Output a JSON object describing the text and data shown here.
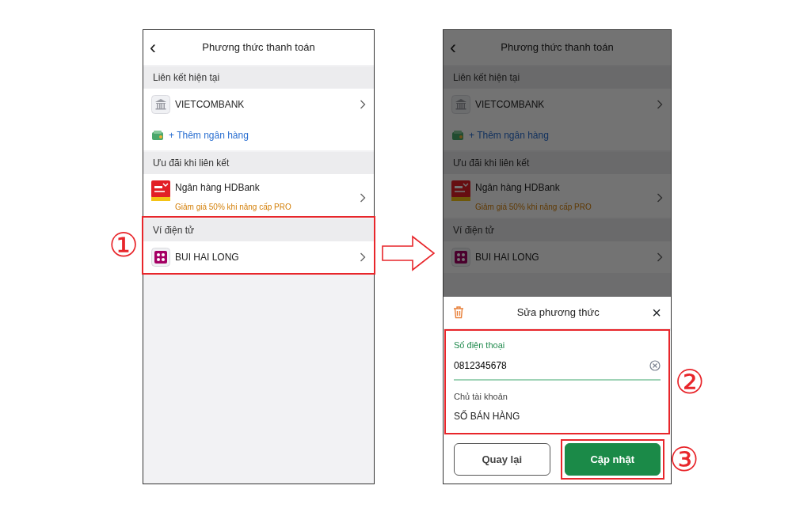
{
  "screens": [
    {
      "header": {
        "back": "‹",
        "title": "Phương thức thanh toán"
      },
      "dimmed": false,
      "sections": [
        {
          "title": "Liên kết hiện tại",
          "highlight": false,
          "rows": [
            {
              "kind": "bank_account",
              "name": "VIETCOMBANK"
            },
            {
              "kind": "add_bank",
              "name": "+ Thêm ngân hàng"
            }
          ]
        },
        {
          "title": "Ưu đãi khi liên kết",
          "highlight": false,
          "rows": [
            {
              "kind": "offer",
              "name": "Ngân hàng HDBank",
              "promo": "Giảm giá 50% khi nâng cấp PRO"
            }
          ]
        },
        {
          "title": "Ví điện tử",
          "highlight": true,
          "step": "①",
          "rows": [
            {
              "kind": "wallet_account",
              "name": "BUI HAI LONG"
            }
          ]
        }
      ]
    },
    {
      "header": {
        "back": "‹",
        "title": "Phương thức thanh toán"
      },
      "dimmed": true,
      "sections": [
        {
          "title": "Liên kết hiện tại",
          "highlight": false,
          "rows": [
            {
              "kind": "bank_account",
              "name": "VIETCOMBANK"
            },
            {
              "kind": "add_bank",
              "name": "+ Thêm ngân hàng"
            }
          ]
        },
        {
          "title": "Ưu đãi khi liên kết",
          "highlight": false,
          "rows": [
            {
              "kind": "offer",
              "name": "Ngân hàng HDBank",
              "promo": "Giảm giá 50% khi nâng cấp PRO"
            }
          ]
        },
        {
          "title": "Ví điện tử",
          "highlight": false,
          "rows": [
            {
              "kind": "wallet_account",
              "name": "BUI HAI LONG"
            }
          ]
        }
      ],
      "sheet": {
        "title": "Sửa phương thức",
        "close": "×",
        "highlight": true,
        "step": "②",
        "fields": [
          {
            "kind": "input",
            "label": "Số điện thoại",
            "value": "0812345678",
            "focused": true
          },
          {
            "kind": "text",
            "label": "Chủ tài khoản",
            "value": "SỐ BÁN HÀNG",
            "focused": false
          }
        ],
        "buttons": [
          {
            "kind": "secondary",
            "label": "Quay lại",
            "highlight": false
          },
          {
            "kind": "primary",
            "label": "Cập nhật",
            "highlight": true,
            "step": "③"
          }
        ]
      }
    }
  ]
}
